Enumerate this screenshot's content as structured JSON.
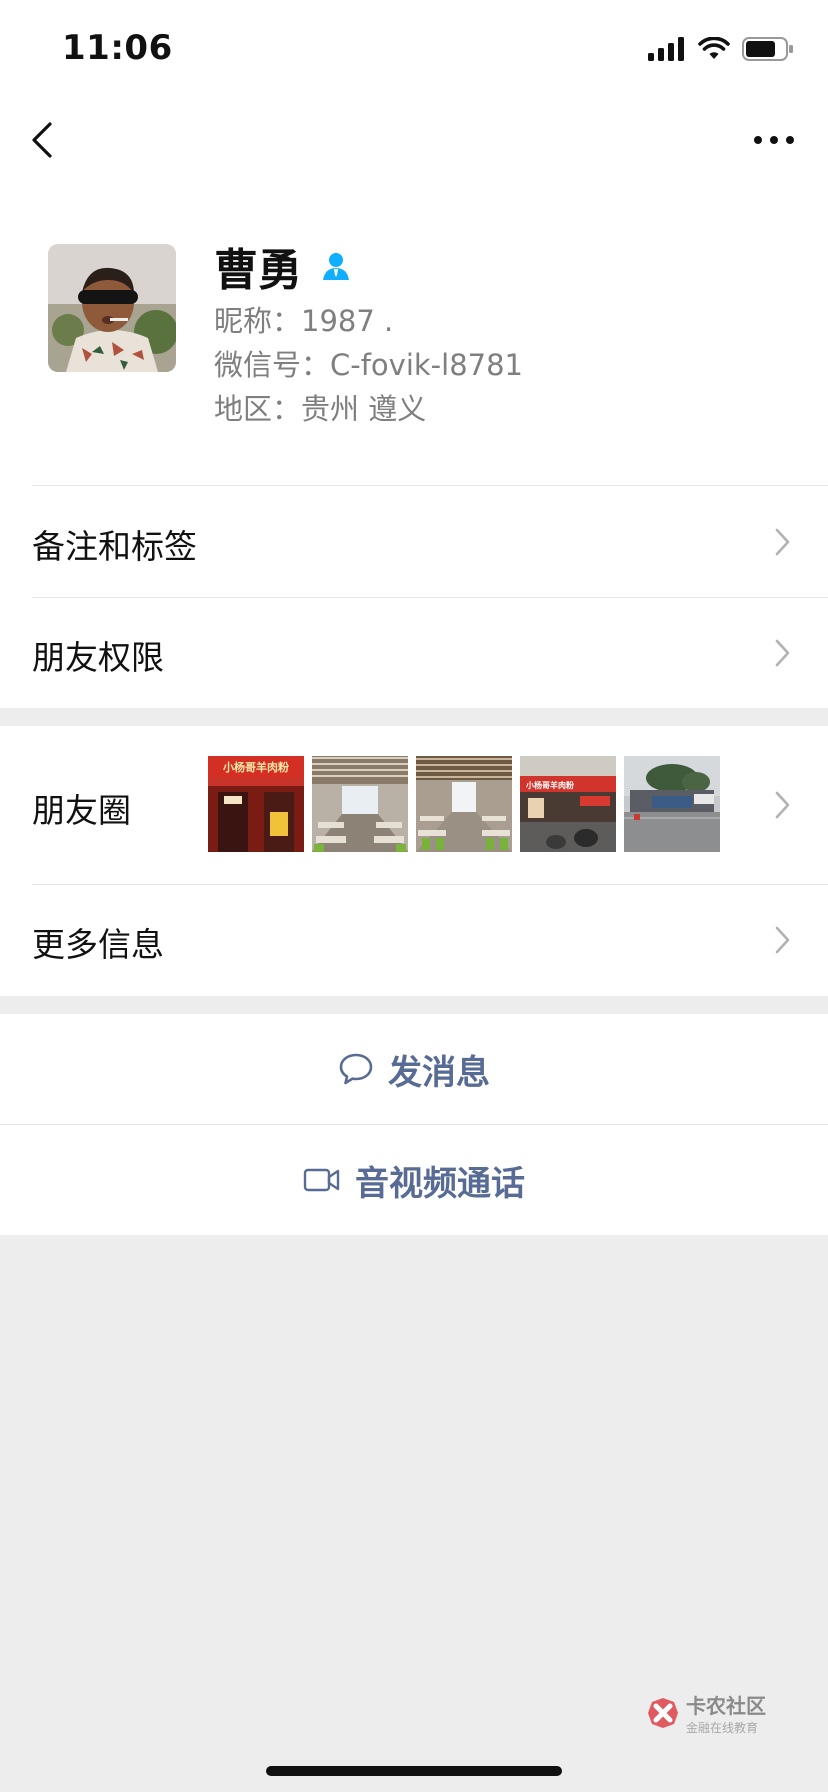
{
  "status": {
    "time": "11:06",
    "battery_level": 0.75
  },
  "profile": {
    "name": "曹勇",
    "nickname": "昵称：1987 .",
    "wechat_id": "微信号：C-fovik-l8781",
    "region": "地区：贵州 遵义"
  },
  "menu": {
    "remark_tags": "备注和标签",
    "friend_permissions": "朋友权限",
    "moments": "朋友圈",
    "more_info": "更多信息"
  },
  "moments_thumbs": [
    {
      "sign": "小杨哥羊肉粉"
    },
    {
      "sign": ""
    },
    {
      "sign": ""
    },
    {
      "sign": "小杨哥羊肉粉"
    },
    {
      "sign": ""
    }
  ],
  "actions": {
    "send_message": "发消息",
    "av_call": "音视频通话"
  },
  "watermark": {
    "title": "卡农社区",
    "subtitle": "金融在线教育"
  },
  "colors": {
    "link_blue": "#576b95",
    "verified_blue": "#10aeff",
    "background": "#ededed"
  }
}
